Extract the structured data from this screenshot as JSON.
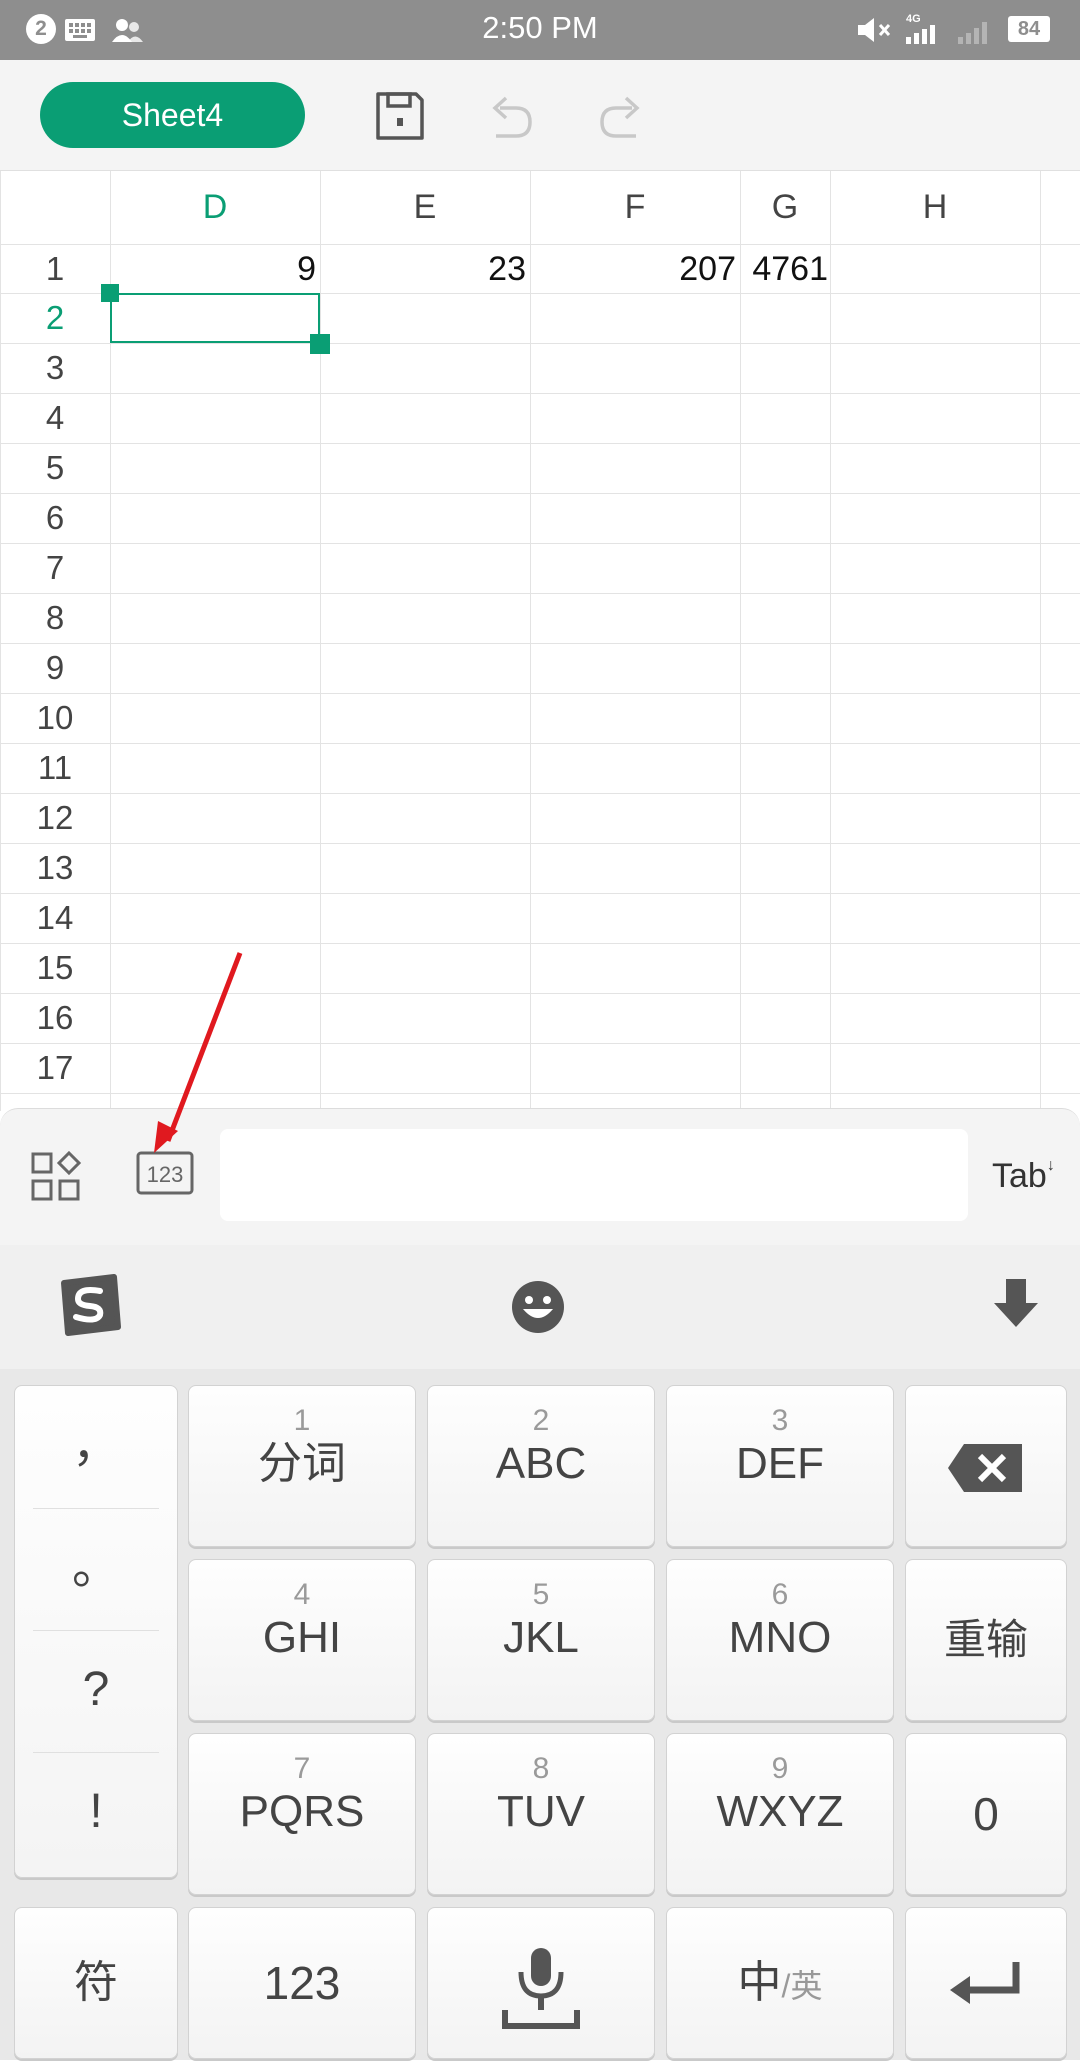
{
  "status_bar": {
    "time": "2:50 PM",
    "notification_count": "2",
    "battery": "84",
    "network": "4G"
  },
  "toolbar": {
    "sheet_name": "Sheet4"
  },
  "grid": {
    "columns": [
      "D",
      "E",
      "F",
      "G",
      "H"
    ],
    "rows": [
      "1",
      "2",
      "3",
      "4",
      "5",
      "6",
      "7",
      "8",
      "9",
      "10",
      "11",
      "12",
      "13",
      "14",
      "15",
      "16",
      "17"
    ],
    "row1": {
      "D": "9",
      "E": "23",
      "F": "207",
      "G": "4761"
    },
    "selected_cell": "D2"
  },
  "input_bar": {
    "tab_label": "Tab",
    "formula_value": ""
  },
  "keyboard": {
    "punctuation": [
      "，",
      "。",
      "?",
      "!"
    ],
    "keys": [
      {
        "num": "1",
        "label": "分词"
      },
      {
        "num": "2",
        "label": "ABC"
      },
      {
        "num": "3",
        "label": "DEF"
      },
      {
        "num": "4",
        "label": "GHI"
      },
      {
        "num": "5",
        "label": "JKL"
      },
      {
        "num": "6",
        "label": "MNO"
      },
      {
        "num": "7",
        "label": "PQRS"
      },
      {
        "num": "8",
        "label": "TUV"
      },
      {
        "num": "9",
        "label": "WXYZ"
      }
    ],
    "reenter": "重输",
    "zero": "0",
    "symbols": "符",
    "numbers": "123",
    "lang_main": "中",
    "lang_sub": "/英"
  },
  "colors": {
    "accent": "#0a9e74",
    "annotation_arrow": "#e0191f",
    "status_bar": "#8e8e8e"
  }
}
